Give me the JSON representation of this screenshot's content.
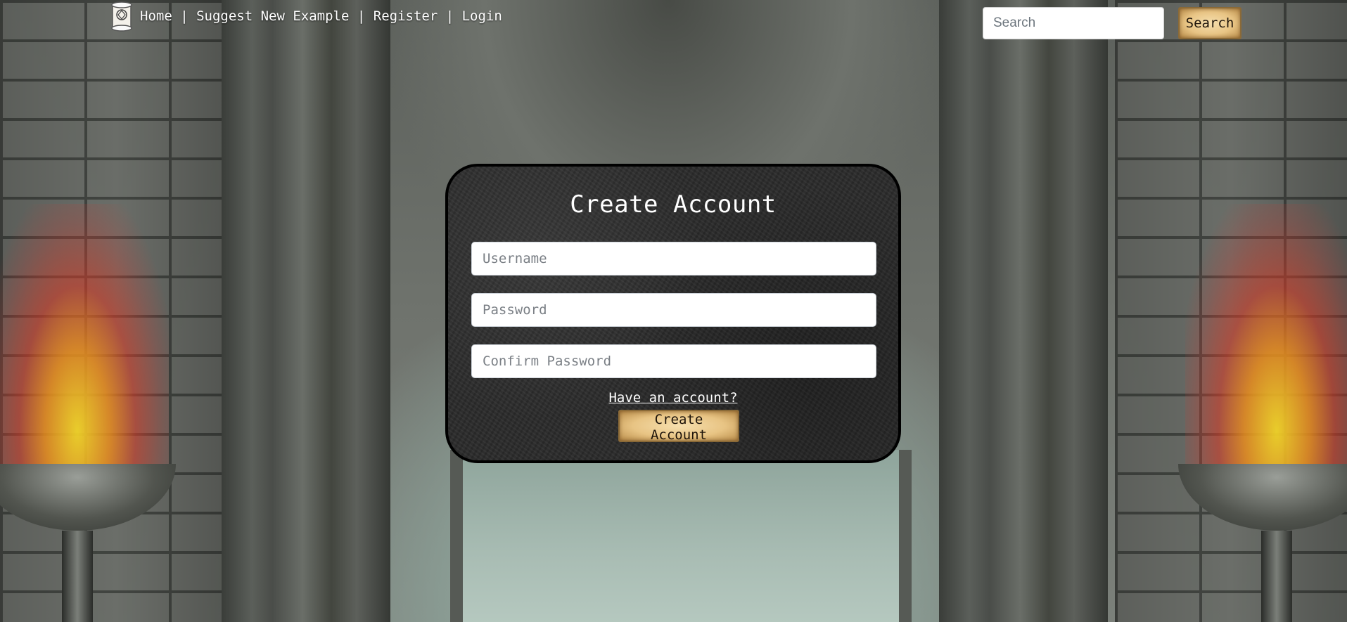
{
  "nav": {
    "home": "Home",
    "sep1": " | ",
    "suggest": "Suggest New Example",
    "sep2": " | ",
    "register": "Register",
    "sep3": " | ",
    "login": "Login"
  },
  "search": {
    "placeholder": "Search",
    "button_label": "Search"
  },
  "form": {
    "title": "Create Account",
    "username_placeholder": "Username",
    "password_placeholder": "Password",
    "confirm_placeholder": "Confirm Password",
    "have_account_link": "Have an account?",
    "submit_label": "Create Account"
  },
  "icons": {
    "logo": "scroll-logo-icon"
  },
  "colors": {
    "button_parchment": "#e8c484",
    "panel_background": "#2b2b2b",
    "panel_border": "#000000",
    "text_light": "#ffffff"
  }
}
